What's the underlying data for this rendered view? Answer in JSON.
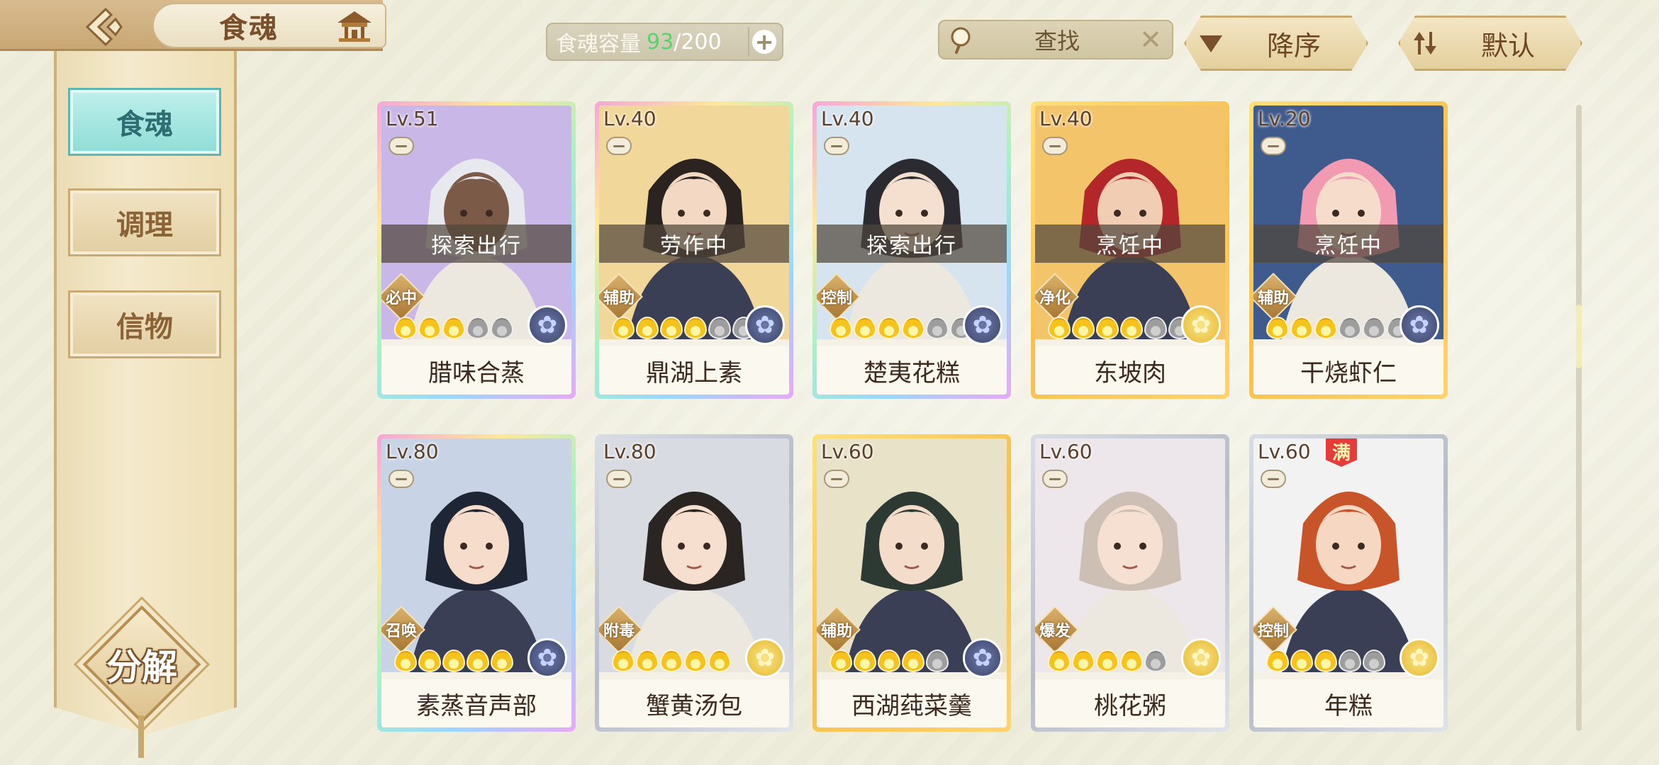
{
  "header": {
    "title": "食魂",
    "capacity_label": "食魂容量",
    "capacity_used": "93",
    "capacity_total": "/200",
    "search_placeholder": "查找",
    "sort_desc_label": "降序",
    "sort_default_label": "默认"
  },
  "sidebar": {
    "tabs": [
      {
        "label": "食魂",
        "active": true
      },
      {
        "label": "调理",
        "active": false
      },
      {
        "label": "信物",
        "active": false
      }
    ],
    "decompose_label": "分解"
  },
  "colors": {
    "capacity_used": "#56d36b",
    "active_tab": "#8fdcd6"
  },
  "cards": [
    {
      "level": "Lv.51",
      "name": "腊味合蒸",
      "status": "探索出行",
      "role": "必中",
      "stars": 5,
      "filled": 3,
      "element": "blue",
      "frame": "rainbow"
    },
    {
      "level": "Lv.40",
      "name": "鼎湖上素",
      "status": "劳作中",
      "role": "辅助",
      "stars": 6,
      "filled": 4,
      "element": "blue",
      "frame": "rainbow"
    },
    {
      "level": "Lv.40",
      "name": "楚夷花糕",
      "status": "探索出行",
      "role": "控制",
      "stars": 6,
      "filled": 4,
      "element": "blue",
      "frame": "rainbow"
    },
    {
      "level": "Lv.40",
      "name": "东坡肉",
      "status": "烹饪中",
      "role": "净化",
      "stars": 6,
      "filled": 4,
      "element": "gold",
      "frame": "gold"
    },
    {
      "level": "Lv.20",
      "name": "干烧虾仁",
      "status": "烹饪中",
      "role": "辅助",
      "stars": 6,
      "filled": 3,
      "element": "blue",
      "frame": "gold"
    },
    {
      "level": "Lv.80",
      "name": "素蒸音声部",
      "status": "",
      "role": "召唤",
      "stars": 5,
      "filled": 5,
      "element": "blue",
      "frame": "rainbow"
    },
    {
      "level": "Lv.80",
      "name": "蟹黄汤包",
      "status": "",
      "role": "附毒",
      "stars": 5,
      "filled": 5,
      "element": "gold",
      "frame": "silver"
    },
    {
      "level": "Lv.60",
      "name": "西湖莼菜羹",
      "status": "",
      "role": "辅助",
      "stars": 5,
      "filled": 4,
      "element": "blue",
      "frame": "gold"
    },
    {
      "level": "Lv.60",
      "name": "桃花粥",
      "status": "",
      "role": "爆发",
      "stars": 5,
      "filled": 4,
      "element": "gold",
      "frame": "silver"
    },
    {
      "level": "Lv.60",
      "name": "年糕",
      "status": "",
      "role": "控制",
      "stars": 5,
      "filled": 3,
      "element": "gold",
      "frame": "silver",
      "badge": "满"
    }
  ]
}
